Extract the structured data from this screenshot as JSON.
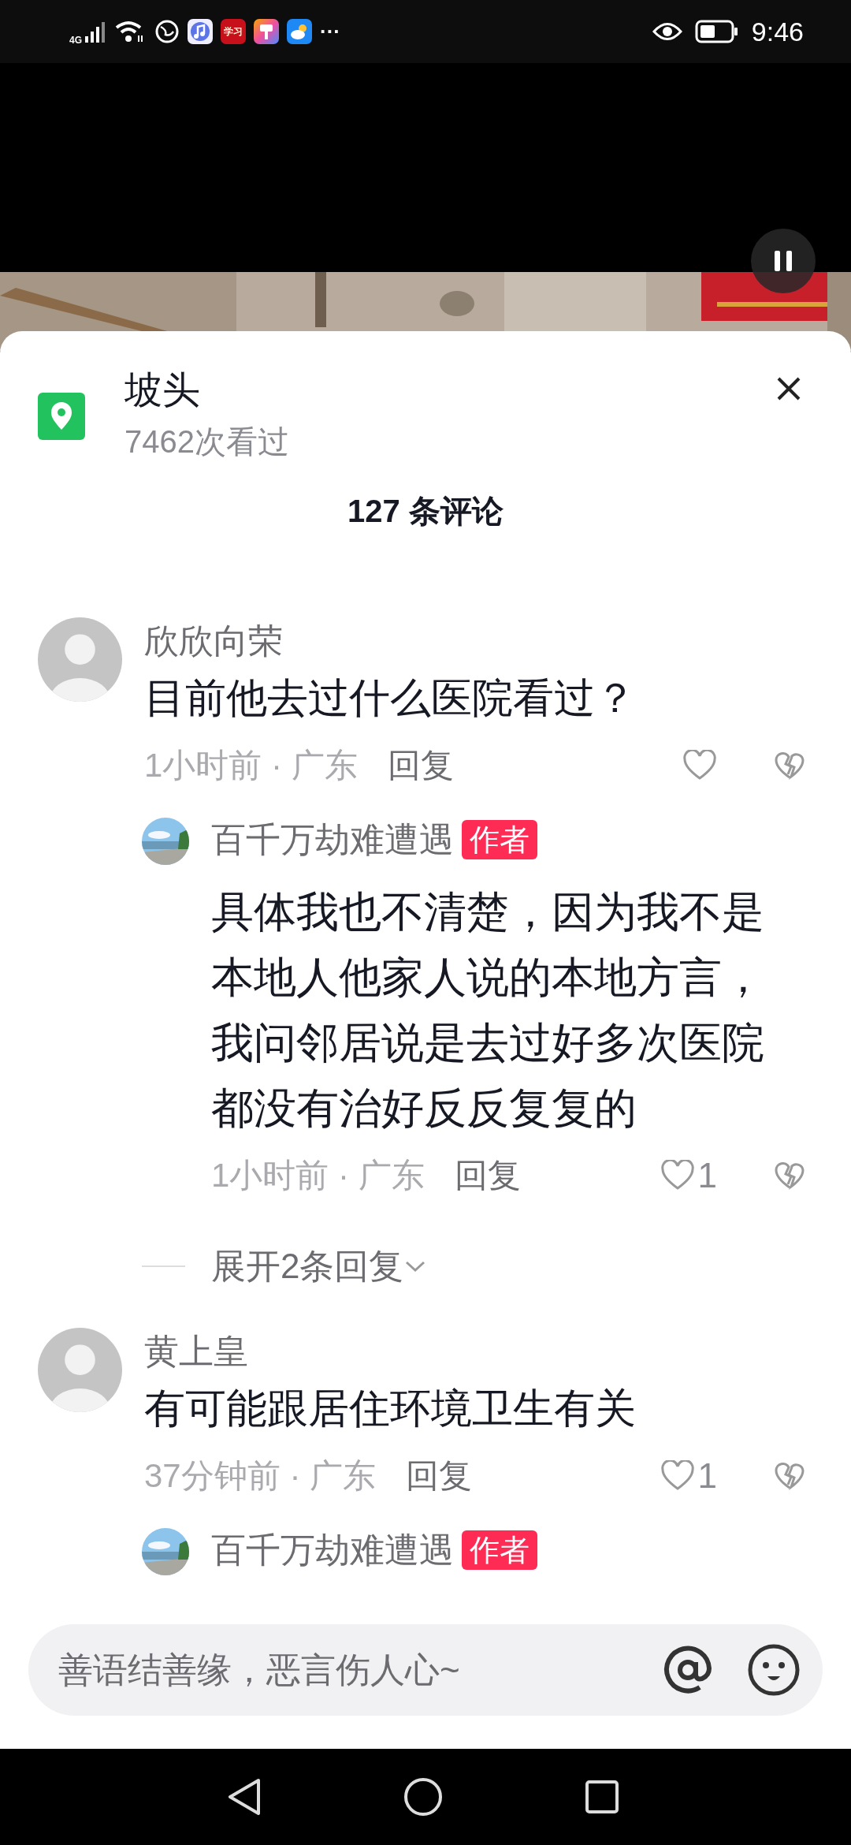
{
  "status_bar": {
    "network": "4G",
    "app_badge": "学习",
    "more": "···",
    "time": "9:46"
  },
  "location": {
    "title": "坡头",
    "views": "7462次看过"
  },
  "comments_header": "127 条评论",
  "comments": [
    {
      "author": "欣欣向荣",
      "text": "目前他去过什么医院看过？",
      "meta": "1小时前 · 广东",
      "reply_label": "回复",
      "replies": [
        {
          "author": "百千万劫难遭遇",
          "badge": "作者",
          "text": "具体我也不清楚，因为我不是本地人他家人说的本地方言，我问邻居说是去过好多次医院都没有治好反反复复的",
          "meta": "1小时前 · 广东",
          "reply_label": "回复",
          "likes": "1"
        }
      ],
      "expand": "展开2条回复"
    },
    {
      "author": "黄上皇",
      "text": "有可能跟居住环境卫生有关",
      "meta": "37分钟前 · 广东",
      "reply_label": "回复",
      "likes": "1",
      "replies": [
        {
          "author": "百千万劫难遭遇",
          "badge": "作者"
        }
      ]
    }
  ],
  "input": {
    "placeholder": "善语结善缘，恶言伤人心~"
  }
}
